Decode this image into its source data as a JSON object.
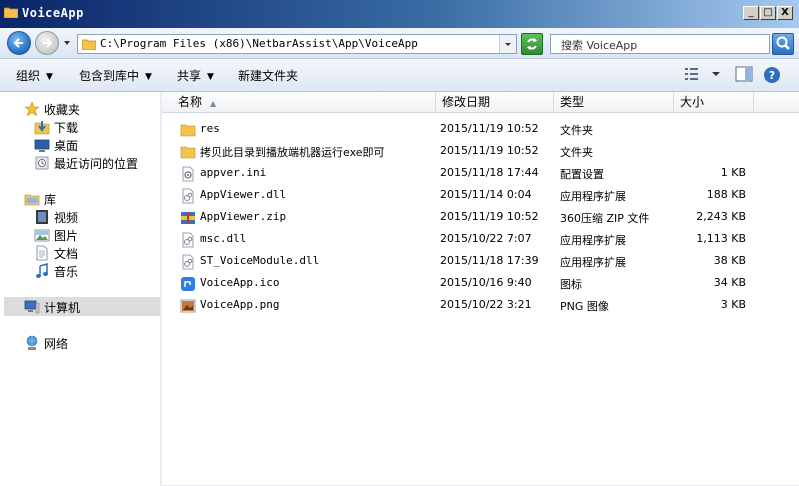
{
  "window": {
    "title": "VoiceApp",
    "controls": {
      "minimize": "_",
      "maximize": "□",
      "close": "X"
    }
  },
  "address": {
    "path": "C:\\Program Files (x86)\\NetbarAssist\\App\\VoiceApp",
    "search_placeholder": "搜索 VoiceApp"
  },
  "toolbar": {
    "organize": "组织",
    "include_in_library": "包含到库中",
    "share": "共享",
    "new_folder": "新建文件夹"
  },
  "sidebar": {
    "favorites": {
      "label": "收藏夹",
      "items": [
        {
          "label": "下载",
          "icon": "download-folder-icon"
        },
        {
          "label": "桌面",
          "icon": "desktop-icon"
        },
        {
          "label": "最近访问的位置",
          "icon": "recent-places-icon"
        }
      ]
    },
    "libraries": {
      "label": "库",
      "items": [
        {
          "label": "视频",
          "icon": "video-library-icon"
        },
        {
          "label": "图片",
          "icon": "pictures-library-icon"
        },
        {
          "label": "文档",
          "icon": "documents-library-icon"
        },
        {
          "label": "音乐",
          "icon": "music-library-icon"
        }
      ]
    },
    "computer": {
      "label": "计算机"
    },
    "network": {
      "label": "网络"
    }
  },
  "columns": {
    "name": "名称",
    "date": "修改日期",
    "type": "类型",
    "size": "大小"
  },
  "files": [
    {
      "name": "res",
      "date": "2015/11/19 10:52",
      "type": "文件夹",
      "size": "",
      "icon": "folder-icon"
    },
    {
      "name": "拷贝此目录到播放端机器运行exe即可",
      "date": "2015/11/19 10:52",
      "type": "文件夹",
      "size": "",
      "icon": "folder-icon"
    },
    {
      "name": "appver.ini",
      "date": "2015/11/18 17:44",
      "type": "配置设置",
      "size": "1 KB",
      "icon": "ini-file-icon"
    },
    {
      "name": "AppViewer.dll",
      "date": "2015/11/14 0:04",
      "type": "应用程序扩展",
      "size": "188 KB",
      "icon": "dll-file-icon"
    },
    {
      "name": "AppViewer.zip",
      "date": "2015/11/19 10:52",
      "type": "360压缩 ZIP 文件",
      "size": "2,243 KB",
      "icon": "zip-file-icon"
    },
    {
      "name": "msc.dll",
      "date": "2015/10/22 7:07",
      "type": "应用程序扩展",
      "size": "1,113 KB",
      "icon": "dll-file-icon"
    },
    {
      "name": "ST_VoiceModule.dll",
      "date": "2015/11/18 17:39",
      "type": "应用程序扩展",
      "size": "38 KB",
      "icon": "dll-file-icon"
    },
    {
      "name": "VoiceApp.ico",
      "date": "2015/10/16 9:40",
      "type": "图标",
      "size": "34 KB",
      "icon": "ico-file-icon"
    },
    {
      "name": "VoiceApp.png",
      "date": "2015/10/22 3:21",
      "type": "PNG 图像",
      "size": "3 KB",
      "icon": "png-file-icon"
    }
  ]
}
